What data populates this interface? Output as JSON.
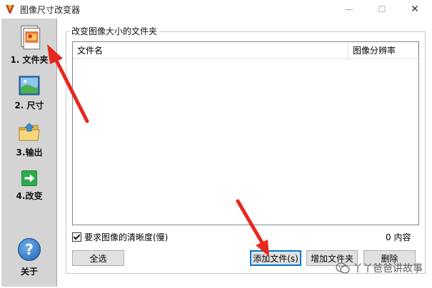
{
  "window": {
    "title": "图像尺寸改变器",
    "min_glyph": "—",
    "max_glyph": "☐",
    "close_glyph": "✕"
  },
  "sidebar": {
    "items": [
      {
        "label": "1. 文件夹",
        "icon": "folder-images-icon"
      },
      {
        "label": "2. 尺寸",
        "icon": "picture-size-icon"
      },
      {
        "label": "3.输出",
        "icon": "output-folder-icon"
      },
      {
        "label": "4.改变",
        "icon": "green-arrow-icon"
      }
    ],
    "about": {
      "label": "关于",
      "icon": "help-icon",
      "glyph": "?"
    }
  },
  "main": {
    "group_title": "改变图像大小的文件夹",
    "list": {
      "columns": [
        "文件名",
        "图像分辨率"
      ],
      "rows": []
    },
    "require_sharpness": {
      "label": "要求图像的清晰度(慢)",
      "checked": true
    },
    "count_text": "0 内容",
    "buttons": {
      "select_all": "全选",
      "add_files": "添加文件(s)",
      "add_folder": "增加文件夹",
      "delete": "删除"
    }
  },
  "watermark": {
    "text": "丫丫爸爸讲故事"
  },
  "colors": {
    "sidebar_bg": "#d4d4d4",
    "annotation_red": "#e8271e",
    "focus_blue": "#0078d7"
  }
}
